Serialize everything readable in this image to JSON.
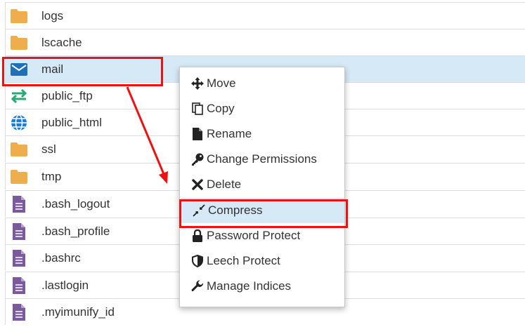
{
  "files": [
    {
      "name": "logs",
      "icon": "folder-icon"
    },
    {
      "name": "lscache",
      "icon": "folder-icon"
    },
    {
      "name": "mail",
      "icon": "mail-icon",
      "selected": true
    },
    {
      "name": "public_ftp",
      "icon": "transfer-arrows-icon"
    },
    {
      "name": "public_html",
      "icon": "globe-icon"
    },
    {
      "name": "ssl",
      "icon": "folder-icon"
    },
    {
      "name": "tmp",
      "icon": "folder-icon"
    },
    {
      "name": ".bash_logout",
      "icon": "text-file-icon"
    },
    {
      "name": ".bash_profile",
      "icon": "text-file-icon"
    },
    {
      "name": ".bashrc",
      "icon": "text-file-icon"
    },
    {
      "name": ".lastlogin",
      "icon": "text-file-icon"
    },
    {
      "name": ".myimunify_id",
      "icon": "text-file-icon"
    }
  ],
  "context_menu": {
    "items": [
      {
        "label": "Move",
        "icon": "move-arrows-icon"
      },
      {
        "label": "Copy",
        "icon": "copy-icon"
      },
      {
        "label": "Rename",
        "icon": "file-icon"
      },
      {
        "label": "Change Permissions",
        "icon": "key-icon"
      },
      {
        "label": "Delete",
        "icon": "x-icon"
      },
      {
        "label": "Compress",
        "icon": "compress-icon",
        "highlighted": true
      },
      {
        "label": "Password Protect",
        "icon": "lock-icon"
      },
      {
        "label": "Leech Protect",
        "icon": "shield-icon"
      },
      {
        "label": "Manage Indices",
        "icon": "wrench-icon"
      }
    ]
  },
  "colors": {
    "folder": "#f0ad4e",
    "mail": "#1e6fb8",
    "transfer": "#2aa876",
    "globe": "#1a7fd4",
    "text_file": "#7a5a9a",
    "annotation": "#ee1111",
    "selected_row": "#d6e9f7"
  }
}
